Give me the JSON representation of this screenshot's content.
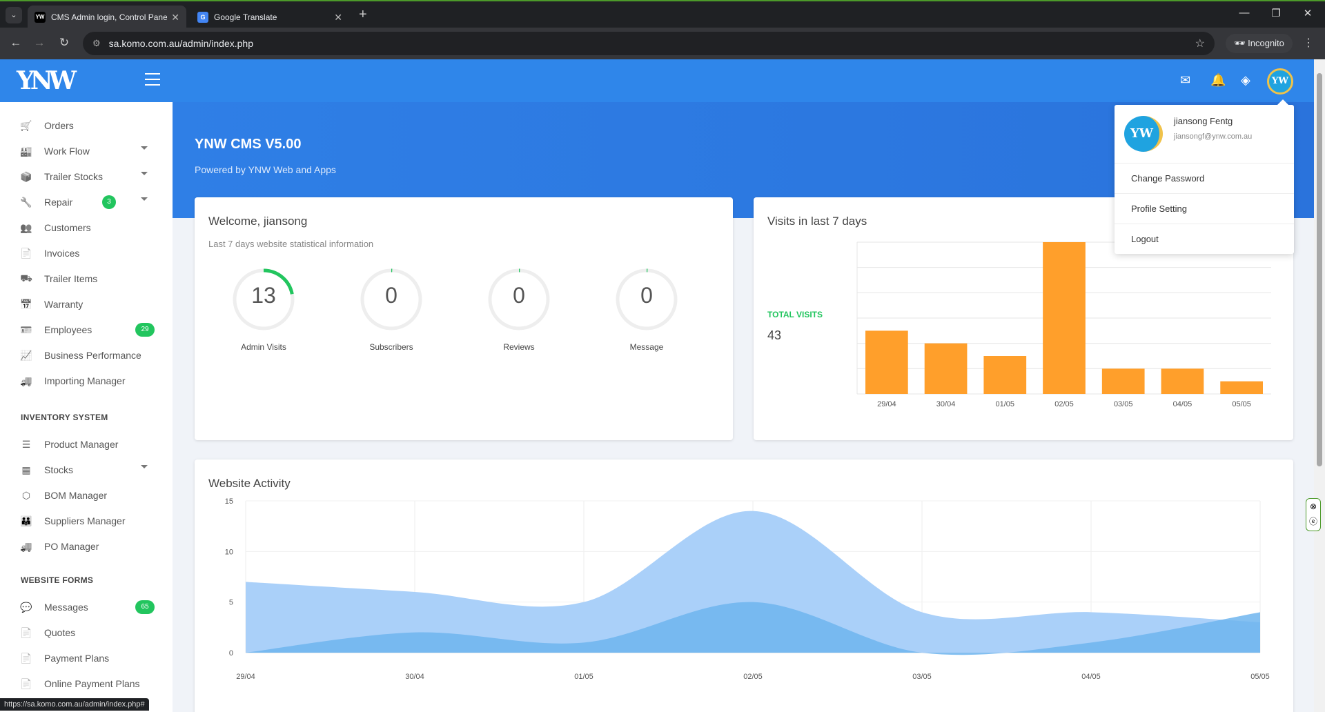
{
  "browser": {
    "tabs": [
      {
        "title": "CMS Admin login, Control Pane",
        "favicon": "ynw-favicon",
        "active": true
      },
      {
        "title": "Google Translate",
        "favicon": "google-translate-favicon",
        "active": false
      }
    ],
    "url": "sa.komo.com.au/admin/index.php",
    "incognito_label": "Incognito",
    "status_url": "https://sa.komo.com.au/admin/index.php#"
  },
  "app": {
    "logo_text": "YNW",
    "accent_color": "#2f86ea",
    "badge_color": "#22c55e"
  },
  "sidebar": {
    "items": [
      {
        "label": "Orders",
        "icon": "cart-icon"
      },
      {
        "label": "Work Flow",
        "icon": "factory-icon",
        "caret": true
      },
      {
        "label": "Trailer Stocks",
        "icon": "boxes-icon",
        "caret": true
      },
      {
        "label": "Repair",
        "icon": "wrench-icon",
        "caret": true,
        "badge": "3"
      },
      {
        "label": "Customers",
        "icon": "users-icon"
      },
      {
        "label": "Invoices",
        "icon": "file-icon"
      },
      {
        "label": "Trailer Items",
        "icon": "dolly-icon"
      },
      {
        "label": "Warranty",
        "icon": "calendar-check-icon"
      },
      {
        "label": "Employees",
        "icon": "id-card-icon",
        "badge": "29"
      },
      {
        "label": "Business Performance",
        "icon": "chart-line-icon"
      },
      {
        "label": "Importing Manager",
        "icon": "truck-icon"
      }
    ],
    "inventory_heading": "INVENTORY SYSTEM",
    "inventory_items": [
      {
        "label": "Product Manager",
        "icon": "list-icon"
      },
      {
        "label": "Stocks",
        "icon": "pallet-icon",
        "caret": true
      },
      {
        "label": "BOM Manager",
        "icon": "cubes-icon"
      },
      {
        "label": "Suppliers Manager",
        "icon": "people-group-icon"
      },
      {
        "label": "PO Manager",
        "icon": "truck-icon"
      }
    ],
    "forms_heading": "WEBSITE FORMS",
    "forms_items": [
      {
        "label": "Messages",
        "icon": "comments-icon",
        "badge": "65"
      },
      {
        "label": "Quotes",
        "icon": "file-icon"
      },
      {
        "label": "Payment Plans",
        "icon": "file-icon"
      },
      {
        "label": "Online Payment Plans",
        "icon": "file-icon"
      }
    ]
  },
  "hero": {
    "title": "YNW CMS V5.00",
    "subtitle": "Powered by YNW Web and Apps"
  },
  "welcome": {
    "title": "Welcome, jiansong",
    "subtitle": "Last 7 days website statistical information",
    "stats": [
      {
        "value": "13",
        "label": "Admin Visits",
        "fraction": 0.22
      },
      {
        "value": "0",
        "label": "Subscribers",
        "fraction": 0.005
      },
      {
        "value": "0",
        "label": "Reviews",
        "fraction": 0.005
      },
      {
        "value": "0",
        "label": "Message",
        "fraction": 0.005
      }
    ]
  },
  "visits": {
    "title": "Visits in last 7 days",
    "total_label": "TOTAL VISITS",
    "total_value": "43"
  },
  "activity": {
    "title": "Website Activity"
  },
  "user_menu": {
    "name": "jiansong Fentg",
    "email": "jiansongf@ynw.com.au",
    "items": [
      "Change Password",
      "Profile Setting",
      "Logout"
    ]
  },
  "chart_data": [
    {
      "type": "bar",
      "title": "Visits in last 7 days",
      "categories": [
        "29/04",
        "30/04",
        "01/05",
        "02/05",
        "03/05",
        "04/05",
        "05/05"
      ],
      "values": [
        5,
        4,
        3,
        12,
        2,
        2,
        1
      ],
      "ylim": [
        0,
        12
      ],
      "grid": true,
      "color": "#ff9f2b"
    },
    {
      "type": "area",
      "title": "Website Activity",
      "x": [
        "29/04",
        "30/04",
        "01/05",
        "02/05",
        "03/05",
        "04/05",
        "05/05"
      ],
      "series": [
        {
          "values": [
            7,
            6,
            5,
            14,
            4,
            4,
            3
          ],
          "color": "#a5cdf9"
        },
        {
          "values": [
            0,
            2,
            1,
            5,
            0,
            1,
            4
          ],
          "color": "#6fb5ee"
        }
      ],
      "ylim": [
        0,
        15
      ],
      "yticks": [
        0,
        5,
        10,
        15
      ],
      "grid": true
    }
  ]
}
